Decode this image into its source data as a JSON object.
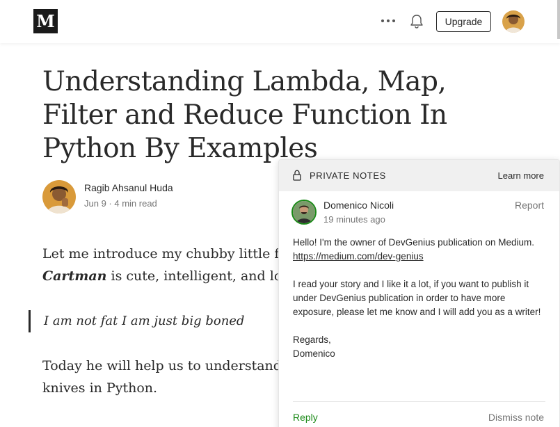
{
  "topbar": {
    "logo_letter": "M",
    "more_icon": "more-horizontal-icon",
    "notifications_icon": "bell-icon",
    "upgrade_label": "Upgrade",
    "user_avatar": "user-avatar-photo"
  },
  "article": {
    "title": "Understanding Lambda, Map, Filter and Reduce Function In Python By Examples",
    "author_name": "Ragib Ahsanul Huda",
    "meta": "Jun 9 · 4 min read",
    "para1_line1": "Let me introduce my chubby little frie",
    "para1_line2_bold": "Cartman",
    "para1_line2_rest": " is cute, intelligent, and loves",
    "quote": "I am not fat I am just big boned",
    "para2_line1": "Today he will help us to understand th",
    "para2_line2": "knives in Python."
  },
  "private_notes": {
    "header_title": "PRIVATE NOTES",
    "learn_more": "Learn more",
    "commenter_name": "Domenico Nicoli",
    "time": "19 minutes ago",
    "report": "Report",
    "body_line1": "Hello! I'm the owner of DevGenius publication on Medium.",
    "link": "https://medium.com/dev-genius",
    "body_para2": "I read your story and I like it a lot, if you want to publish it under DevGenius publication in order to have more exposure, please let me know and I will add you as a writer!",
    "regards": "Regards,",
    "signature": "Domenico",
    "reply": "Reply",
    "dismiss": "Dismiss note"
  },
  "colors": {
    "accent_green": "#1a8917",
    "text_dark": "#292929",
    "text_muted": "#757575",
    "header_bg": "#f0f0f0"
  }
}
